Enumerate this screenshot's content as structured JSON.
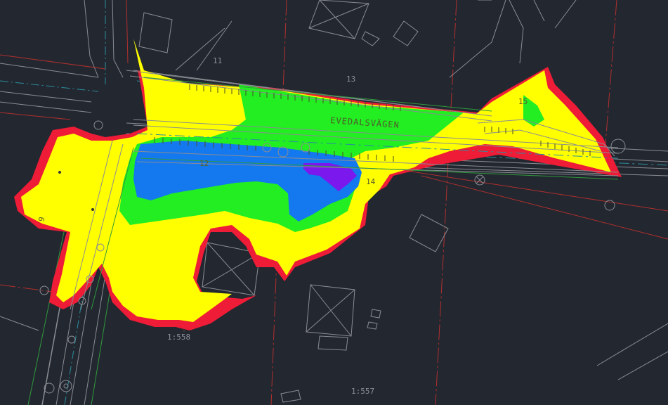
{
  "map": {
    "street_name": "EVEDALSVÄGEN",
    "parcel_numbers": [
      "11",
      "12",
      "13",
      "14",
      "15"
    ],
    "side_label": "9",
    "scale_labels": [
      "1:558",
      "1:557"
    ]
  },
  "colors": {
    "background": "#232730",
    "line_gray": "#8a8d92",
    "property_red": "#b0302e",
    "axis_cyan": "#2b8e9e",
    "edge_green": "#2f9a3c",
    "flood_red": "#ee1c36",
    "flood_yellow": "#ffff00",
    "flood_green": "#22ee22",
    "flood_blue": "#1478ee",
    "flood_purple": "#7a18ee"
  }
}
